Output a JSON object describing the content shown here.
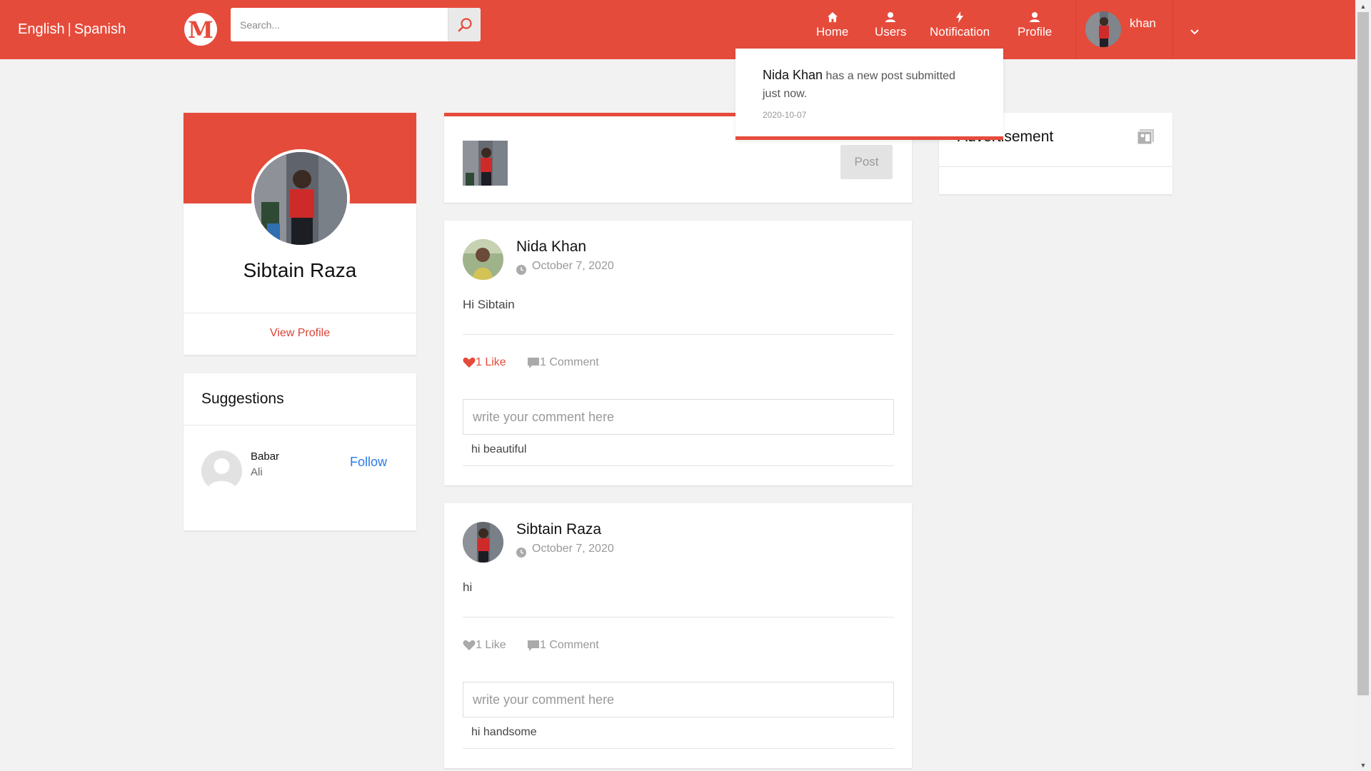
{
  "header": {
    "lang_english": "English",
    "lang_separator": "|",
    "lang_spanish": "Spanish",
    "logo_letter": "M",
    "search_placeholder": "Search...",
    "nav": {
      "home": "Home",
      "users": "Users",
      "notification": "Notification",
      "profile": "Profile"
    },
    "username": "khan",
    "brand_color": "#e54b3b"
  },
  "notification": {
    "who": "Nida Khan",
    "message": " has a new post submitted just now.",
    "date": "2020-10-07"
  },
  "profile": {
    "name": "Sibtain Raza",
    "view_profile_label": "View Profile"
  },
  "suggestions": {
    "title": "Suggestions",
    "items": [
      {
        "first_name": "Babar",
        "last_name": "Ali",
        "follow_label": "Follow"
      }
    ]
  },
  "composer": {
    "post_label": "Post"
  },
  "advertisement": {
    "title": "Advertisement"
  },
  "posts": [
    {
      "author": "Nida Khan",
      "date": "October 7, 2020",
      "body": "Hi Sibtain",
      "likes": "1 Like",
      "liked": true,
      "comments": "1 Comment",
      "comment_placeholder": "write your comment here",
      "comment_text": "hi beautiful"
    },
    {
      "author": "Sibtain Raza",
      "date": "October 7, 2020",
      "body": "hi",
      "likes": "1 Like",
      "liked": false,
      "comments": "1 Comment",
      "comment_placeholder": "write your comment here",
      "comment_text": "hi handsome"
    }
  ]
}
